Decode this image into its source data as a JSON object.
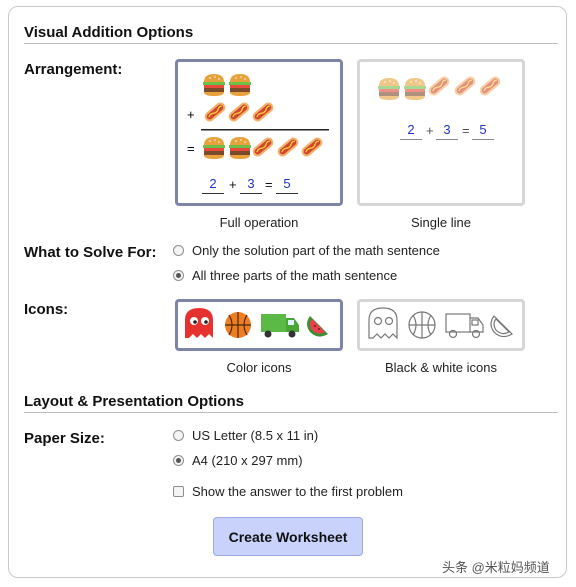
{
  "visual": {
    "title": "Visual Addition Options",
    "arrangement": {
      "label": "Arrangement:",
      "options": [
        {
          "caption": "Full operation",
          "selected": true,
          "plus": "+",
          "equals": "=",
          "a": "2",
          "b": "3",
          "c": "5",
          "op_plus": "+",
          "op_eq": "="
        },
        {
          "caption": "Single line",
          "selected": false,
          "a": "2",
          "b": "3",
          "c": "5",
          "op_plus": "+",
          "op_eq": "="
        }
      ]
    },
    "solve_for": {
      "label": "What to Solve For:",
      "options": [
        {
          "label": "Only the solution part of the math sentence",
          "selected": false
        },
        {
          "label": "All three parts of the math sentence",
          "selected": true
        }
      ]
    },
    "icons": {
      "label": "Icons:",
      "options": [
        {
          "caption": "Color icons",
          "selected": true
        },
        {
          "caption": "Black & white icons",
          "selected": false
        }
      ]
    }
  },
  "layout": {
    "title": "Layout & Presentation Options",
    "paper": {
      "label": "Paper Size:",
      "options": [
        {
          "label": "US Letter (8.5 x 11 in)",
          "selected": false
        },
        {
          "label": "A4 (210 x 297 mm)",
          "selected": true
        }
      ]
    },
    "show_answer": {
      "label": "Show the answer to the first problem",
      "checked": false
    },
    "create_button": "Create Worksheet"
  },
  "watermark": "头条 @米粒妈频道",
  "colors": {
    "selected_border": "#7d85a6",
    "button_bg": "#c8d2fb",
    "number_blue": "#2233cc"
  }
}
